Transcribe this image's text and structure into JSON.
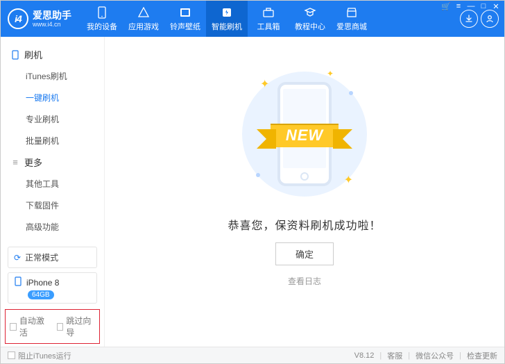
{
  "brand": {
    "cn": "爱思助手",
    "en": "www.i4.cn",
    "logo_text": "i4"
  },
  "nav": [
    {
      "label": "我的设备"
    },
    {
      "label": "应用游戏"
    },
    {
      "label": "铃声壁纸"
    },
    {
      "label": "智能刷机",
      "active": true
    },
    {
      "label": "工具箱"
    },
    {
      "label": "教程中心"
    },
    {
      "label": "爱思商城"
    }
  ],
  "sidebar": {
    "sections": [
      {
        "title": "刷机",
        "items": [
          {
            "label": "iTunes刷机"
          },
          {
            "label": "一键刷机",
            "active": true
          },
          {
            "label": "专业刷机"
          },
          {
            "label": "批量刷机"
          }
        ]
      },
      {
        "title": "更多",
        "items": [
          {
            "label": "其他工具"
          },
          {
            "label": "下载固件"
          },
          {
            "label": "高级功能"
          }
        ]
      }
    ],
    "mode": "正常模式",
    "device": {
      "name": "iPhone 8",
      "storage": "64GB"
    },
    "options": {
      "auto_activate": "自动激活",
      "skip_guide": "跳过向导"
    }
  },
  "main": {
    "ribbon": "NEW",
    "success_text": "恭喜您，保资料刷机成功啦！",
    "confirm": "确定",
    "view_log": "查看日志"
  },
  "footer": {
    "block_itunes": "阻止iTunes运行",
    "version": "V8.12",
    "support": "客服",
    "wechat": "微信公众号",
    "check_update": "检查更新"
  }
}
